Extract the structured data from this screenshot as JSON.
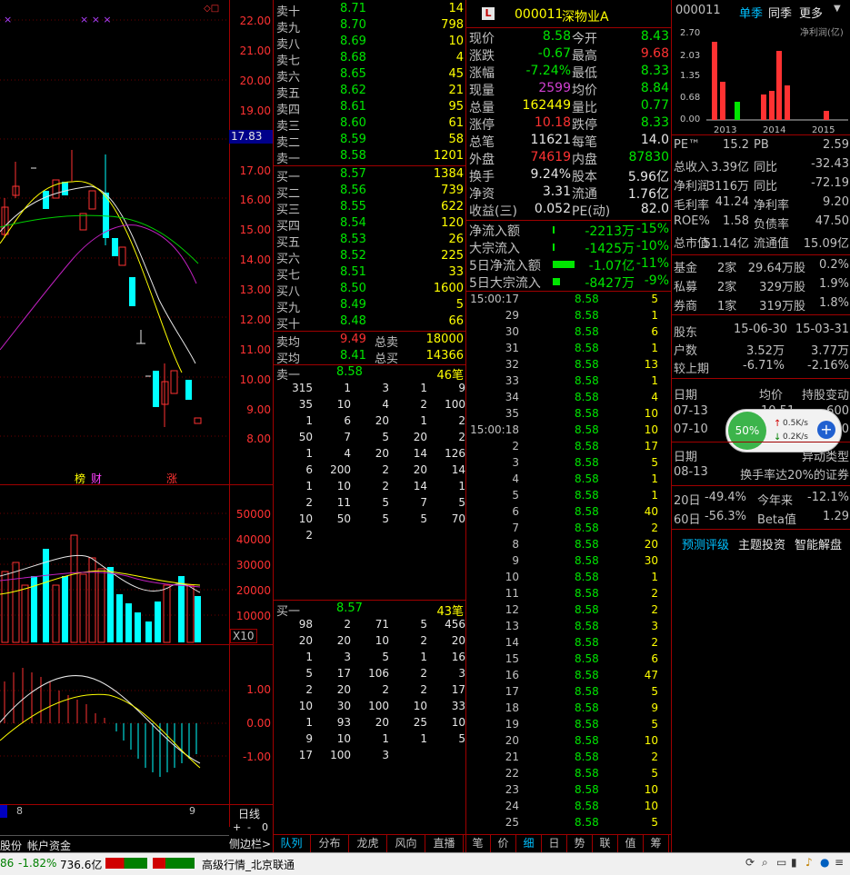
{
  "chart": {
    "price_axis": [
      "22.00",
      "21.00",
      "20.00",
      "19.00",
      "18.00",
      "17.00",
      "16.00",
      "15.00",
      "14.00",
      "13.00",
      "12.00",
      "11.00",
      "10.00",
      "9.00",
      "8.00"
    ],
    "current_price_marker": "17.83",
    "volume_axis": [
      "50000",
      "40000",
      "30000",
      "20000",
      "10000"
    ],
    "volume_unit": "X10",
    "macd_axis": [
      "1.00",
      "0.00",
      "-1.00"
    ],
    "tags": [
      "榜",
      "财",
      "涨"
    ],
    "marks": "× × ×",
    "date_left": "8",
    "date_right": "9",
    "period_label": "日线",
    "sidebar_label": "侧边栏>",
    "zoom": [
      "+",
      "-",
      "0"
    ]
  },
  "orderbook": {
    "sells": [
      {
        "label": "卖十",
        "price": "8.71",
        "vol": "14"
      },
      {
        "label": "卖九",
        "price": "8.70",
        "vol": "798"
      },
      {
        "label": "卖八",
        "price": "8.69",
        "vol": "10"
      },
      {
        "label": "卖七",
        "price": "8.68",
        "vol": "4"
      },
      {
        "label": "卖六",
        "price": "8.65",
        "vol": "45"
      },
      {
        "label": "卖五",
        "price": "8.62",
        "vol": "21"
      },
      {
        "label": "卖四",
        "price": "8.61",
        "vol": "95"
      },
      {
        "label": "卖三",
        "price": "8.60",
        "vol": "61"
      },
      {
        "label": "卖二",
        "price": "8.59",
        "vol": "58"
      },
      {
        "label": "卖一",
        "price": "8.58",
        "vol": "1201"
      }
    ],
    "buys": [
      {
        "label": "买一",
        "price": "8.57",
        "vol": "1384"
      },
      {
        "label": "买二",
        "price": "8.56",
        "vol": "739"
      },
      {
        "label": "买三",
        "price": "8.55",
        "vol": "622"
      },
      {
        "label": "买四",
        "price": "8.54",
        "vol": "120"
      },
      {
        "label": "买五",
        "price": "8.53",
        "vol": "26"
      },
      {
        "label": "买六",
        "price": "8.52",
        "vol": "225"
      },
      {
        "label": "买七",
        "price": "8.51",
        "vol": "33"
      },
      {
        "label": "买八",
        "price": "8.50",
        "vol": "1600"
      },
      {
        "label": "买九",
        "price": "8.49",
        "vol": "5"
      },
      {
        "label": "买十",
        "price": "8.48",
        "vol": "66"
      }
    ],
    "avg_sell_label": "卖均",
    "avg_sell": "9.49",
    "total_sell_label": "总卖",
    "total_sell": "18000",
    "avg_buy_label": "买均",
    "avg_buy": "8.41",
    "total_buy_label": "总买",
    "total_buy": "14366",
    "queue_sell_label": "卖一",
    "queue_sell_price": "8.58",
    "queue_sell_count": "46笔",
    "queue_sell": [
      [
        "315",
        "1",
        "3",
        "1",
        "9"
      ],
      [
        "35",
        "10",
        "4",
        "2",
        "100"
      ],
      [
        "1",
        "6",
        "20",
        "1",
        "2"
      ],
      [
        "50",
        "7",
        "5",
        "20",
        "2"
      ],
      [
        "1",
        "4",
        "20",
        "14",
        "126"
      ],
      [
        "6",
        "200",
        "2",
        "20",
        "14"
      ],
      [
        "1",
        "10",
        "2",
        "14",
        "1"
      ],
      [
        "2",
        "11",
        "5",
        "7",
        "5"
      ],
      [
        "10",
        "50",
        "5",
        "5",
        "70"
      ],
      [
        "2",
        "",
        "",
        "",
        ""
      ]
    ],
    "queue_buy_label": "买一",
    "queue_buy_price": "8.57",
    "queue_buy_count": "43笔",
    "queue_buy": [
      [
        "98",
        "2",
        "71",
        "5",
        "456"
      ],
      [
        "20",
        "20",
        "10",
        "2",
        "20"
      ],
      [
        "1",
        "3",
        "5",
        "1",
        "16"
      ],
      [
        "5",
        "17",
        "106",
        "2",
        "3"
      ],
      [
        "2",
        "20",
        "2",
        "2",
        "17"
      ],
      [
        "10",
        "30",
        "100",
        "10",
        "33"
      ],
      [
        "1",
        "93",
        "20",
        "25",
        "10"
      ],
      [
        "9",
        "10",
        "1",
        "1",
        "5"
      ],
      [
        "17",
        "100",
        "3",
        "",
        ""
      ]
    ]
  },
  "quote": {
    "logo": "L",
    "code": "000011",
    "name": "深物业A",
    "rows": [
      {
        "k1": "现价",
        "v1": "8.58",
        "c1": "green",
        "k2": "今开",
        "v2": "8.43",
        "c2": "green"
      },
      {
        "k1": "涨跌",
        "v1": "-0.67",
        "c1": "green",
        "k2": "最高",
        "v2": "9.68",
        "c2": "red"
      },
      {
        "k1": "涨幅",
        "v1": "-7.24%",
        "c1": "green",
        "k2": "最低",
        "v2": "8.33",
        "c2": "green"
      },
      {
        "k1": "现量",
        "v1": "2599",
        "c1": "mag",
        "k2": "均价",
        "v2": "8.84",
        "c2": "green"
      },
      {
        "k1": "总量",
        "v1": "162449",
        "c1": "yellow",
        "k2": "量比",
        "v2": "0.77",
        "c2": "green"
      },
      {
        "k1": "涨停",
        "v1": "10.18",
        "c1": "red",
        "k2": "跌停",
        "v2": "8.33",
        "c2": "green"
      },
      {
        "k1": "总笔",
        "v1": "11621",
        "c1": "white",
        "k2": "每笔",
        "v2": "14.0",
        "c2": "white"
      },
      {
        "k1": "外盘",
        "v1": "74619",
        "c1": "red",
        "k2": "内盘",
        "v2": "87830",
        "c2": "green"
      },
      {
        "k1": "换手",
        "v1": "9.24%",
        "c1": "white",
        "k2": "股本",
        "v2": "5.96亿",
        "c2": "white"
      },
      {
        "k1": "净资",
        "v1": "3.31",
        "c1": "white",
        "k2": "流通",
        "v2": "1.76亿",
        "c2": "white"
      },
      {
        "k1": "收益(三)",
        "v1": "0.052",
        "c1": "white",
        "k2": "PE(动)",
        "v2": "82.0",
        "c2": "white"
      }
    ],
    "flows": [
      {
        "k": "净流入额",
        "v": "-2213万",
        "p": "-15%"
      },
      {
        "k": "大宗流入",
        "v": "-1425万",
        "p": "-10%"
      },
      {
        "k": "5日净流入额",
        "v": "-1.07亿",
        "p": "-11%"
      },
      {
        "k": "5日大宗流入",
        "v": "-8427万",
        "p": "-9%"
      }
    ]
  },
  "ticks": [
    {
      "t": "15:00:17",
      "p": "8.58",
      "v": "5"
    },
    {
      "t": "29",
      "p": "8.58",
      "v": "1"
    },
    {
      "t": "30",
      "p": "8.58",
      "v": "6"
    },
    {
      "t": "31",
      "p": "8.58",
      "v": "1"
    },
    {
      "t": "32",
      "p": "8.58",
      "v": "13"
    },
    {
      "t": "33",
      "p": "8.58",
      "v": "1"
    },
    {
      "t": "34",
      "p": "8.58",
      "v": "4"
    },
    {
      "t": "35",
      "p": "8.58",
      "v": "10"
    },
    {
      "t": "15:00:18",
      "p": "8.58",
      "v": "10"
    },
    {
      "t": "2",
      "p": "8.58",
      "v": "17"
    },
    {
      "t": "3",
      "p": "8.58",
      "v": "5"
    },
    {
      "t": "4",
      "p": "8.58",
      "v": "1"
    },
    {
      "t": "5",
      "p": "8.58",
      "v": "1"
    },
    {
      "t": "6",
      "p": "8.58",
      "v": "40"
    },
    {
      "t": "7",
      "p": "8.58",
      "v": "2"
    },
    {
      "t": "8",
      "p": "8.58",
      "v": "20"
    },
    {
      "t": "9",
      "p": "8.58",
      "v": "30"
    },
    {
      "t": "10",
      "p": "8.58",
      "v": "1"
    },
    {
      "t": "11",
      "p": "8.58",
      "v": "2"
    },
    {
      "t": "12",
      "p": "8.58",
      "v": "2"
    },
    {
      "t": "13",
      "p": "8.58",
      "v": "3"
    },
    {
      "t": "14",
      "p": "8.58",
      "v": "2"
    },
    {
      "t": "15",
      "p": "8.58",
      "v": "6"
    },
    {
      "t": "16",
      "p": "8.58",
      "v": "47"
    },
    {
      "t": "17",
      "p": "8.58",
      "v": "5"
    },
    {
      "t": "18",
      "p": "8.58",
      "v": "9"
    },
    {
      "t": "19",
      "p": "8.58",
      "v": "5"
    },
    {
      "t": "20",
      "p": "8.58",
      "v": "10"
    },
    {
      "t": "21",
      "p": "8.58",
      "v": "2"
    },
    {
      "t": "22",
      "p": "8.58",
      "v": "5"
    },
    {
      "t": "23",
      "p": "8.58",
      "v": "10"
    },
    {
      "t": "24",
      "p": "8.58",
      "v": "10"
    },
    {
      "t": "25",
      "p": "8.58",
      "v": "5"
    }
  ],
  "fundamentals": {
    "header_code": "000011",
    "header_tabs": [
      "单季",
      "同季",
      "更多"
    ],
    "mini_chart_label": "净利润(亿)",
    "mini_axis": [
      "2.70",
      "2.03",
      "1.35",
      "0.68",
      "0.00"
    ],
    "mini_years": [
      "2013",
      "2014",
      "2015"
    ],
    "rows1": [
      {
        "k1": "PE™",
        "v1": "15.2",
        "k2": "PB",
        "v2": "2.59"
      },
      {
        "k1": "总收入",
        "v1": "3.39亿",
        "k2": "同比",
        "v2": "-32.43"
      },
      {
        "k1": "净利润",
        "v1": "3116万",
        "k2": "同比",
        "v2": "-72.19"
      },
      {
        "k1": "毛利率",
        "v1": "41.24",
        "k2": "净利率",
        "v2": "9.20"
      },
      {
        "k1": "ROE%",
        "v1": "1.58",
        "k2": "负债率",
        "v2": "47.50"
      },
      {
        "k1": "总市值",
        "v1": "51.14亿",
        "k2": "流通值",
        "v2": "15.09亿"
      }
    ],
    "holders": [
      {
        "k": "基金",
        "n": "2家",
        "s": "29.64万股",
        "p": "0.2%"
      },
      {
        "k": "私募",
        "n": "2家",
        "s": "329万股",
        "p": "1.9%"
      },
      {
        "k": "券商",
        "n": "1家",
        "s": "319万股",
        "p": "1.8%"
      }
    ],
    "shareholder_label": "股东",
    "d1": "15-06-30",
    "d2": "15-03-31",
    "households_label": "户数",
    "h1": "3.52万",
    "h2": "3.77万",
    "change_label": "较上期",
    "c1": "-6.71%",
    "c2": "-2.16%",
    "date_header": "日期",
    "avg_header": "均价",
    "hold_header": "持股变动",
    "date_rows": [
      {
        "d": "07-13",
        "a": "10.51",
        "h": "-600"
      },
      {
        "d": "07-10",
        "a": "",
        "h": "-600"
      }
    ],
    "abnormal_date_label": "日期",
    "abnormal_type_label": "异动类型",
    "abnormal_date": "08-13",
    "abnormal_text": "换手率达20%的证券",
    "perf": [
      {
        "k": "20日",
        "v": "-49.4%",
        "k2": "今年来",
        "v2": "-12.1%"
      },
      {
        "k": "60日",
        "v": "-56.3%",
        "k2": "Beta值",
        "v2": "1.29"
      }
    ],
    "links": [
      "预测评级",
      "主题投资",
      "智能解盘"
    ],
    "widget_pct": "50%",
    "widget_up": "0.5K/s",
    "widget_down": "0.2K/s"
  },
  "tabs_ob": [
    "队列",
    "分布",
    "龙虎",
    "风向",
    "直播"
  ],
  "tabs_tick": [
    "笔",
    "价",
    "细",
    "日",
    "势",
    "联",
    "值",
    "筹"
  ],
  "bottom_left_tabs": [
    "股份",
    "帐户资金"
  ],
  "status": {
    "idx": "86",
    "pct": "-1.82%",
    "amount": "736.6亿",
    "feed": "高级行情_北京联通"
  }
}
